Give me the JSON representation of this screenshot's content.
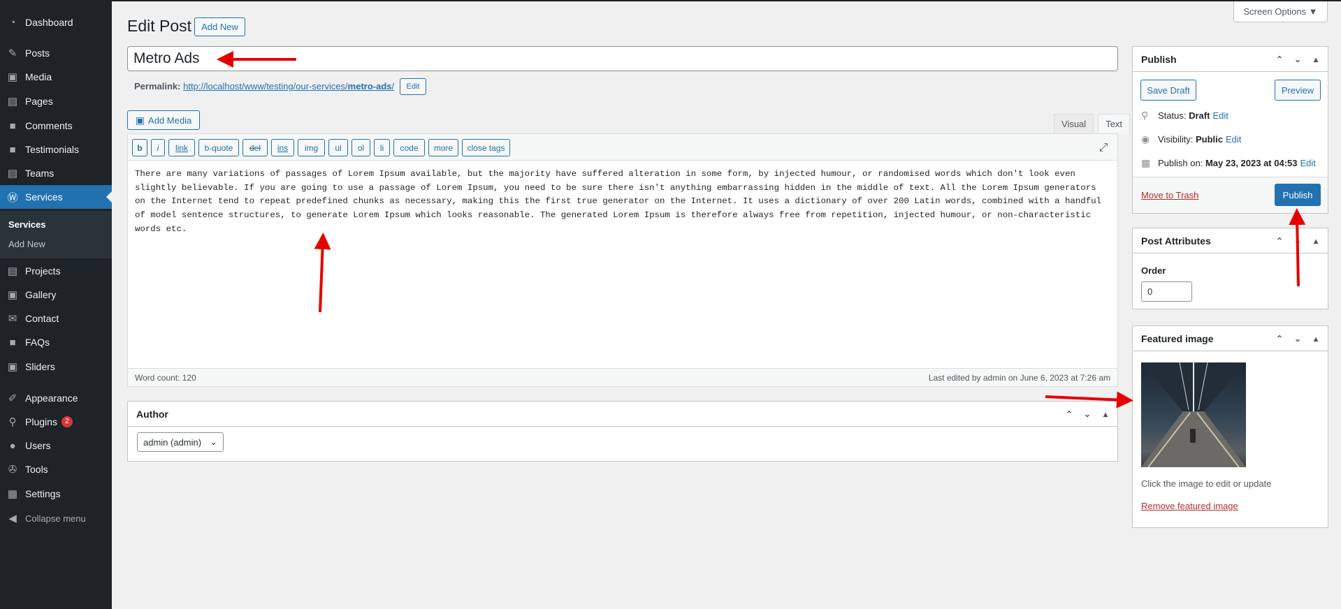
{
  "sidebar": {
    "items": [
      {
        "label": "Dashboard",
        "icon": "dashboard-icon"
      },
      {
        "label": "Posts",
        "icon": "pin-icon"
      },
      {
        "label": "Media",
        "icon": "media-icon"
      },
      {
        "label": "Pages",
        "icon": "pages-icon"
      },
      {
        "label": "Comments",
        "icon": "comments-icon"
      },
      {
        "label": "Testimonials",
        "icon": "comments-icon"
      },
      {
        "label": "Teams",
        "icon": "pages-icon"
      },
      {
        "label": "Services",
        "icon": "wordpress-icon"
      },
      {
        "label": "Projects",
        "icon": "pages-icon"
      },
      {
        "label": "Gallery",
        "icon": "media-icon"
      },
      {
        "label": "Contact",
        "icon": "mail-icon"
      },
      {
        "label": "FAQs",
        "icon": "comments-icon"
      },
      {
        "label": "Sliders",
        "icon": "media-icon"
      },
      {
        "label": "Appearance",
        "icon": "brush-icon"
      },
      {
        "label": "Plugins",
        "icon": "plugin-icon",
        "badge": "2"
      },
      {
        "label": "Users",
        "icon": "user-icon"
      },
      {
        "label": "Tools",
        "icon": "wrench-icon"
      },
      {
        "label": "Settings",
        "icon": "settings-icon"
      }
    ],
    "submenu": {
      "current": "Services",
      "add_new": "Add New"
    },
    "collapse": "Collapse menu"
  },
  "header": {
    "title": "Edit Post",
    "add_new": "Add New",
    "screen_options": "Screen Options ▼"
  },
  "post": {
    "title": "Metro Ads",
    "permalink_label": "Permalink:",
    "permalink_base": "http://localhost/www/testing/our-services/",
    "permalink_slug": "metro-ads",
    "permalink_end": "/",
    "permalink_edit": "Edit"
  },
  "editor": {
    "add_media": "Add Media",
    "tabs": [
      "Visual",
      "Text"
    ],
    "quicktags": [
      "b",
      "i",
      "link",
      "b-quote",
      "del",
      "ins",
      "img",
      "ul",
      "ol",
      "li",
      "code",
      "more",
      "close tags"
    ],
    "content": "There are many variations of passages of Lorem Ipsum available, but the majority have suffered alteration in some form, by injected humour, or randomised words which don't look even slightly believable. If you are going to use a passage of Lorem Ipsum, you need to be sure there isn't anything embarrassing hidden in the middle of text. All the Lorem Ipsum generators on the Internet tend to repeat predefined chunks as necessary, making this the first true generator on the Internet. It uses a dictionary of over 200 Latin words, combined with a handful of model sentence structures, to generate Lorem Ipsum which looks reasonable. The generated Lorem Ipsum is therefore always free from repetition, injected humour, or non-characteristic words etc.",
    "word_count": "Word count: 120",
    "last_edited": "Last edited by admin on June 6, 2023 at 7:26 am"
  },
  "author_box": {
    "title": "Author",
    "selected": "admin (admin)"
  },
  "publish_box": {
    "title": "Publish",
    "save_draft": "Save Draft",
    "preview": "Preview",
    "status_label": "Status:",
    "status_value": "Draft",
    "visibility_label": "Visibility:",
    "visibility_value": "Public",
    "publish_on_label": "Publish on:",
    "publish_on_value": "May 23, 2023 at 04:53",
    "edit": "Edit",
    "move_to_trash": "Move to Trash",
    "publish": "Publish"
  },
  "attributes_box": {
    "title": "Post Attributes",
    "order_label": "Order",
    "order_value": "0"
  },
  "featured_box": {
    "title": "Featured image",
    "hint": "Click the image to edit or update",
    "remove": "Remove featured image"
  },
  "colors": {
    "sidebar": "#1d2327",
    "accent": "#2271b1",
    "annotation": "#e50000",
    "danger": "#b32d2e"
  }
}
